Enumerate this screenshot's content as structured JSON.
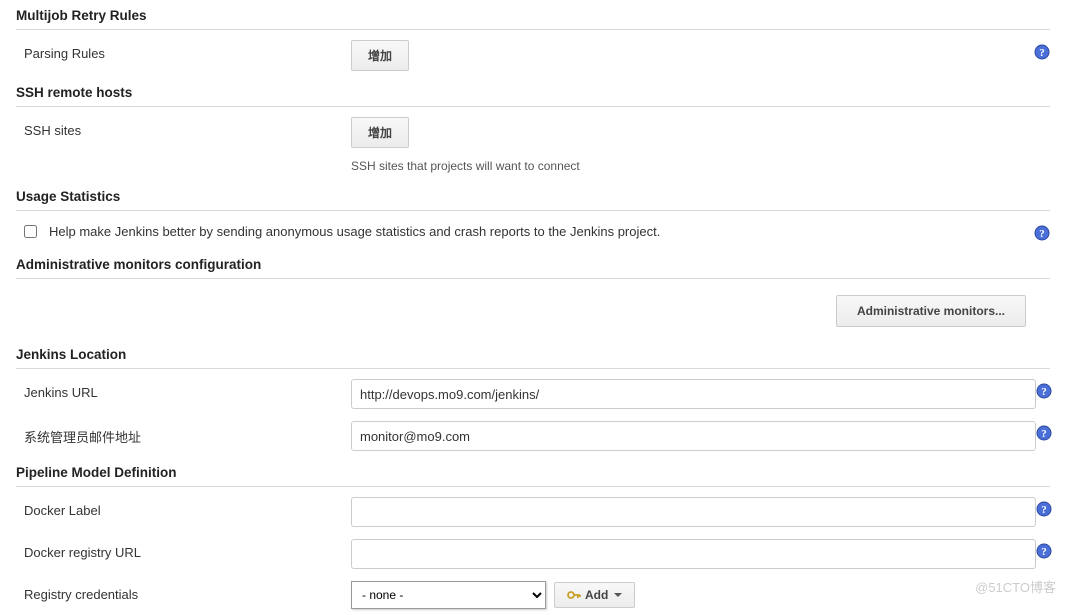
{
  "sections": {
    "multijob": {
      "title": "Multijob Retry Rules",
      "parsing_rules_label": "Parsing Rules",
      "add_btn": "增加"
    },
    "ssh": {
      "title": "SSH remote hosts",
      "sites_label": "SSH sites",
      "add_btn": "增加",
      "desc": "SSH sites that projects will want to connect"
    },
    "usage": {
      "title": "Usage Statistics",
      "checkbox_label": "Help make Jenkins better by sending anonymous usage statistics and crash reports to the Jenkins project."
    },
    "admin_monitors": {
      "title": "Administrative monitors configuration",
      "btn": "Administrative monitors..."
    },
    "jenkins_location": {
      "title": "Jenkins Location",
      "url_label": "Jenkins URL",
      "url_value": "http://devops.mo9.com/jenkins/",
      "admin_email_label": "系统管理员邮件地址",
      "admin_email_value": "monitor@mo9.com"
    },
    "pipeline": {
      "title": "Pipeline Model Definition",
      "docker_label": "Docker Label",
      "docker_label_value": "",
      "docker_registry_label": "Docker registry URL",
      "docker_registry_value": "",
      "registry_credentials_label": "Registry credentials",
      "credentials_selected": "- none -",
      "add_btn": "Add"
    }
  },
  "watermark": "@51CTO博客"
}
